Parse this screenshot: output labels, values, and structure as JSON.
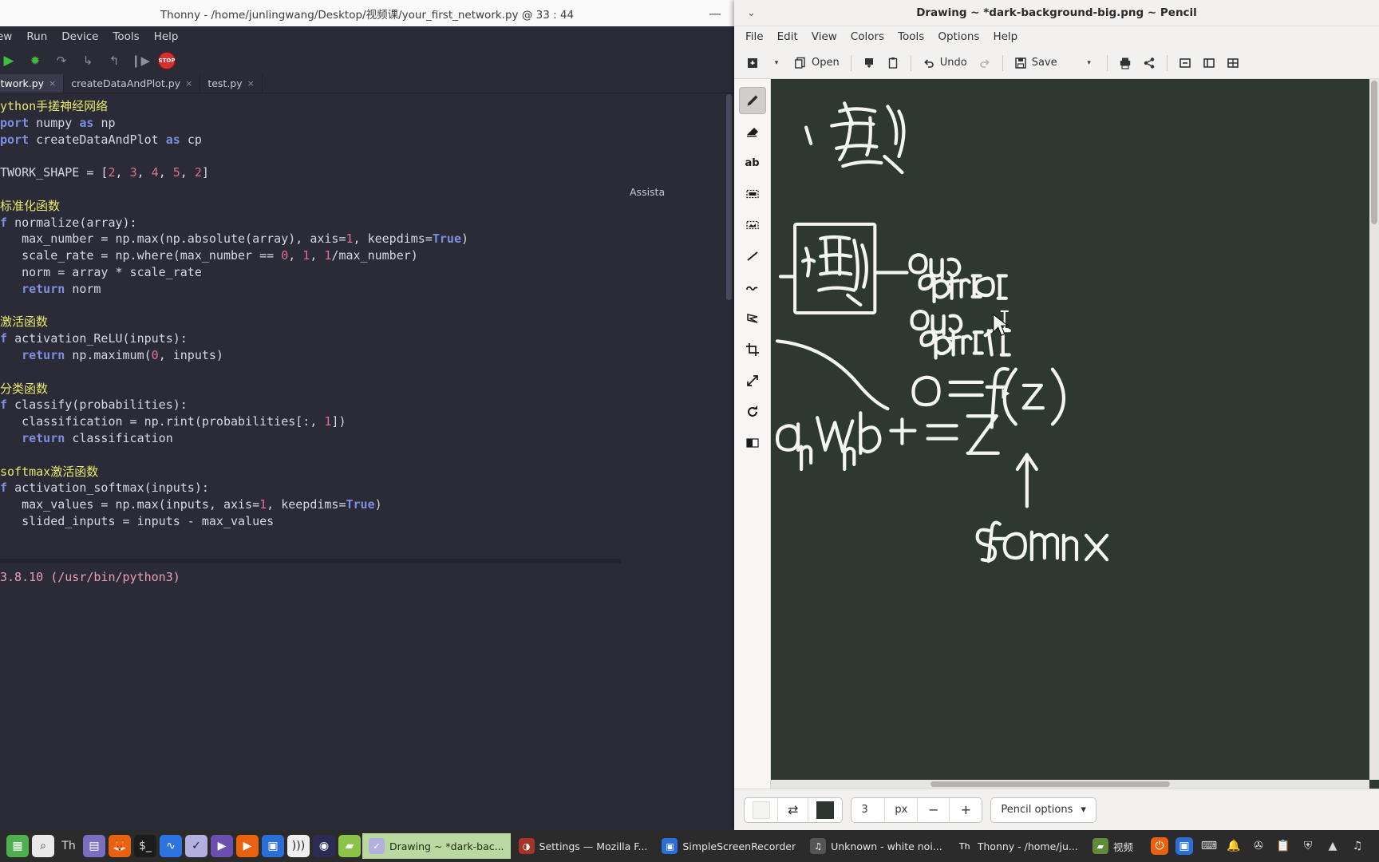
{
  "thonny": {
    "title": "Thonny  -  /home/junlingwang/Desktop/视频课/your_first_network.py  @  33 : 44",
    "minimize": "—",
    "menus": [
      "ew",
      "Run",
      "Device",
      "Tools",
      "Help"
    ],
    "tabs": [
      {
        "label": "network.py",
        "close": "×",
        "active": true
      },
      {
        "label": "createDataAndPlot.py",
        "close": "×",
        "active": false
      },
      {
        "label": "test.py",
        "close": "×",
        "active": false
      }
    ],
    "assistant_label": "Assista",
    "code_lines": [
      {
        "t": "comment",
        "text": "ython手搓神经网络"
      },
      {
        "t": "mixed",
        "parts": [
          {
            "c": "kw",
            "s": "port "
          },
          {
            "c": "name",
            "s": "numpy "
          },
          {
            "c": "kw",
            "s": "as "
          },
          {
            "c": "name",
            "s": "np"
          }
        ]
      },
      {
        "t": "mixed",
        "parts": [
          {
            "c": "kw",
            "s": "port "
          },
          {
            "c": "name",
            "s": "createDataAndPlot "
          },
          {
            "c": "kw",
            "s": "as "
          },
          {
            "c": "name",
            "s": "cp"
          }
        ]
      },
      {
        "t": "blank",
        "text": ""
      },
      {
        "t": "mixed",
        "parts": [
          {
            "c": "name",
            "s": "TWORK_SHAPE = ["
          },
          {
            "c": "num",
            "s": "2"
          },
          {
            "c": "name",
            "s": ", "
          },
          {
            "c": "num",
            "s": "3"
          },
          {
            "c": "name",
            "s": ", "
          },
          {
            "c": "num",
            "s": "4"
          },
          {
            "c": "name",
            "s": ", "
          },
          {
            "c": "num",
            "s": "5"
          },
          {
            "c": "name",
            "s": ", "
          },
          {
            "c": "num",
            "s": "2"
          },
          {
            "c": "name",
            "s": "]"
          }
        ]
      },
      {
        "t": "blank",
        "text": ""
      },
      {
        "t": "comment",
        "text": "标准化函数"
      },
      {
        "t": "mixed",
        "parts": [
          {
            "c": "kw",
            "s": "f "
          },
          {
            "c": "name",
            "s": "normalize(array):"
          }
        ]
      },
      {
        "t": "mixed",
        "parts": [
          {
            "c": "name",
            "s": "   max_number = np.max(np.absolute(array), axis="
          },
          {
            "c": "num",
            "s": "1"
          },
          {
            "c": "name",
            "s": ", keepdims="
          },
          {
            "c": "kw",
            "s": "True"
          },
          {
            "c": "name",
            "s": ")"
          }
        ]
      },
      {
        "t": "mixed",
        "parts": [
          {
            "c": "name",
            "s": "   scale_rate = np.where(max_number == "
          },
          {
            "c": "num",
            "s": "0"
          },
          {
            "c": "name",
            "s": ", "
          },
          {
            "c": "num",
            "s": "1"
          },
          {
            "c": "name",
            "s": ", "
          },
          {
            "c": "num",
            "s": "1"
          },
          {
            "c": "name",
            "s": "/max_number)"
          }
        ]
      },
      {
        "t": "mixed",
        "parts": [
          {
            "c": "name",
            "s": "   norm = array * scale_rate"
          }
        ]
      },
      {
        "t": "mixed",
        "parts": [
          {
            "c": "name",
            "s": "   "
          },
          {
            "c": "kw",
            "s": "return "
          },
          {
            "c": "name",
            "s": "norm"
          }
        ]
      },
      {
        "t": "blank",
        "text": ""
      },
      {
        "t": "comment",
        "text": "激活函数"
      },
      {
        "t": "mixed",
        "parts": [
          {
            "c": "kw",
            "s": "f "
          },
          {
            "c": "name",
            "s": "activation_ReLU(inputs):"
          }
        ]
      },
      {
        "t": "mixed",
        "parts": [
          {
            "c": "name",
            "s": "   "
          },
          {
            "c": "kw",
            "s": "return "
          },
          {
            "c": "name",
            "s": "np.maximum("
          },
          {
            "c": "num",
            "s": "0"
          },
          {
            "c": "name",
            "s": ", inputs)"
          }
        ]
      },
      {
        "t": "blank",
        "text": ""
      },
      {
        "t": "comment",
        "text": "分类函数"
      },
      {
        "t": "mixed",
        "parts": [
          {
            "c": "kw",
            "s": "f "
          },
          {
            "c": "name",
            "s": "classify(probabilities):"
          }
        ]
      },
      {
        "t": "mixed",
        "parts": [
          {
            "c": "name",
            "s": "   classification = np.rint(probabilities[:, "
          },
          {
            "c": "num",
            "s": "1"
          },
          {
            "c": "name",
            "s": "])"
          }
        ]
      },
      {
        "t": "mixed",
        "parts": [
          {
            "c": "name",
            "s": "   "
          },
          {
            "c": "kw",
            "s": "return "
          },
          {
            "c": "name",
            "s": "classification"
          }
        ]
      },
      {
        "t": "blank",
        "text": ""
      },
      {
        "t": "comment",
        "text": "softmax激活函数"
      },
      {
        "t": "mixed",
        "parts": [
          {
            "c": "kw",
            "s": "f "
          },
          {
            "c": "name",
            "s": "activation_softmax(inputs):"
          }
        ]
      },
      {
        "t": "mixed",
        "parts": [
          {
            "c": "name",
            "s": "   max_values = np.max(inputs, axis="
          },
          {
            "c": "num",
            "s": "1"
          },
          {
            "c": "name",
            "s": ", keepdims="
          },
          {
            "c": "kw",
            "s": "True"
          },
          {
            "c": "name",
            "s": ")"
          }
        ]
      },
      {
        "t": "mixed",
        "parts": [
          {
            "c": "name",
            "s": "   slided_inputs = inputs - max_values"
          }
        ]
      }
    ],
    "shell_text": "3.8.10 (/usr/bin/python3)"
  },
  "pencil": {
    "title": "Drawing ~ *dark-background-big.png ~ Pencil",
    "window_chevron": "⌄",
    "menus": [
      "File",
      "Edit",
      "View",
      "Colors",
      "Tools",
      "Options",
      "Help"
    ],
    "toolbar": {
      "new_label": "",
      "open_label": "Open",
      "undo_label": "Undo",
      "redo_label": "",
      "save_label": "Save",
      "caret": "▾"
    },
    "tools": [
      {
        "name": "pencil-tool",
        "glyph": "✎",
        "selected": true
      },
      {
        "name": "eraser-tool",
        "glyph": "◣",
        "selected": false
      },
      {
        "name": "text-tool",
        "glyph": "ab",
        "selected": false
      },
      {
        "name": "select-rect-tool",
        "glyph": "▪",
        "selected": false
      },
      {
        "name": "select-free-tool",
        "glyph": "▰",
        "selected": false
      },
      {
        "name": "line-tool",
        "glyph": "╲",
        "selected": false
      },
      {
        "name": "curve-tool",
        "glyph": "⌒",
        "selected": false
      },
      {
        "name": "polygon-tool",
        "glyph": "⌧",
        "selected": false
      },
      {
        "name": "crop-tool",
        "glyph": "⊹",
        "selected": false
      },
      {
        "name": "scale-tool",
        "glyph": "⤢",
        "selected": false
      },
      {
        "name": "rotate-tool",
        "glyph": "⟳",
        "selected": false
      },
      {
        "name": "filters-tool",
        "glyph": "▥",
        "selected": false
      }
    ],
    "bottombar": {
      "size_value": "3",
      "size_unit": "px",
      "minus": "−",
      "plus": "+",
      "options_label": "Pencil options",
      "options_caret": "▾",
      "swap_glyph": "⇄",
      "fg_color": "#2c352f",
      "bg_color": "#f4f4f2"
    },
    "canvas": {
      "background": "#2d3832",
      "annotations": [
        {
          "id": "cn-shu",
          "text": "数"
        },
        {
          "id": "cn-ji-box",
          "text": "激"
        },
        {
          "id": "output0",
          "text": "output[0]"
        },
        {
          "id": "output1",
          "text": "output[1]"
        },
        {
          "id": "formula-o",
          "text": "o = f(z)"
        },
        {
          "id": "formula-wb",
          "text": "anWn+b = z"
        },
        {
          "id": "softmax-label",
          "text": "softmax"
        },
        {
          "id": "arrow-up",
          "text": "↑"
        }
      ]
    }
  },
  "taskbar": {
    "launchers": [
      {
        "name": "show-applications-icon",
        "glyph": "▦",
        "bg": "#4fae4f"
      },
      {
        "name": "search-icon",
        "glyph": "⌕",
        "bg": "#e9e9e9",
        "fg": "#333"
      },
      {
        "name": "thonny-icon",
        "glyph": "Th",
        "bg": "#2b2b2b",
        "fg": "#ddd"
      },
      {
        "name": "text-editor-icon",
        "glyph": "▤",
        "bg": "#7a6fbe"
      },
      {
        "name": "firefox-icon",
        "glyph": "🦊",
        "bg": "#e8620f"
      },
      {
        "name": "terminal-icon",
        "glyph": "$_",
        "bg": "#1c1c1c",
        "fg": "#ddd"
      },
      {
        "name": "audacity-icon",
        "glyph": "∿",
        "bg": "#2e74e0"
      },
      {
        "name": "checkmark-icon",
        "glyph": "✓",
        "bg": "#b3b0e0",
        "fg": "#222"
      },
      {
        "name": "videoplayer-icon",
        "glyph": "▶",
        "bg": "#6b4fb0"
      },
      {
        "name": "vlc-icon",
        "glyph": "▶",
        "bg": "#e8620f"
      },
      {
        "name": "screenshot-icon",
        "glyph": "▣",
        "bg": "#2b6fd6"
      },
      {
        "name": "recorder-icon",
        "glyph": ")))",
        "bg": "#efefef",
        "fg": "#222"
      },
      {
        "name": "ubuntu-icon",
        "glyph": "◉",
        "bg": "#2b2b55"
      },
      {
        "name": "files-icon",
        "glyph": "▰",
        "bg": "#8bc34a"
      }
    ],
    "windows": [
      {
        "name": "taskbar-window-drawing",
        "icon": "✓",
        "icon_bg": "#b3b0e0",
        "label": "Drawing ~ *dark-bac...",
        "active": true
      },
      {
        "name": "taskbar-window-settings",
        "icon": "◑",
        "icon_bg": "#a4342a",
        "label": "Settings — Mozilla F...",
        "active": false
      },
      {
        "name": "taskbar-window-recorder",
        "icon": "▣",
        "icon_bg": "#2b6fd6",
        "label": "SimpleScreenRecorder",
        "active": false
      },
      {
        "name": "taskbar-window-music",
        "icon": "♫",
        "icon_bg": "#555",
        "label": "Unknown - white noi...",
        "active": false
      },
      {
        "name": "taskbar-window-thonny",
        "icon": "Th",
        "icon_bg": "#2b2b2b",
        "label": "Thonny  -  /home/ju...",
        "active": false
      },
      {
        "name": "taskbar-window-videos",
        "icon": "▰",
        "icon_bg": "#5f8b3a",
        "label": "视频",
        "active": false
      }
    ],
    "tray": [
      {
        "name": "power-icon",
        "glyph": "⏻",
        "bg": "#e8620f"
      },
      {
        "name": "camera-icon",
        "glyph": "▣",
        "bg": "#2b6fd6"
      },
      {
        "name": "keyboard-icon",
        "glyph": "⌨",
        "bg": "#2b2b2b"
      },
      {
        "name": "notification-bell-icon",
        "glyph": "🔔",
        "bg": "#2b2b2b"
      },
      {
        "name": "bluetooth-icon",
        "glyph": "✇",
        "bg": "#2b2b2b"
      },
      {
        "name": "clipboard-icon",
        "glyph": "📋",
        "bg": "#2b2b2b"
      },
      {
        "name": "shield-icon",
        "glyph": "⛨",
        "bg": "#2b2b2b"
      },
      {
        "name": "wifi-icon",
        "glyph": "▲",
        "bg": "#2b2b2b"
      },
      {
        "name": "volume-icon",
        "glyph": "♫",
        "bg": "#2b2b2b"
      }
    ]
  }
}
